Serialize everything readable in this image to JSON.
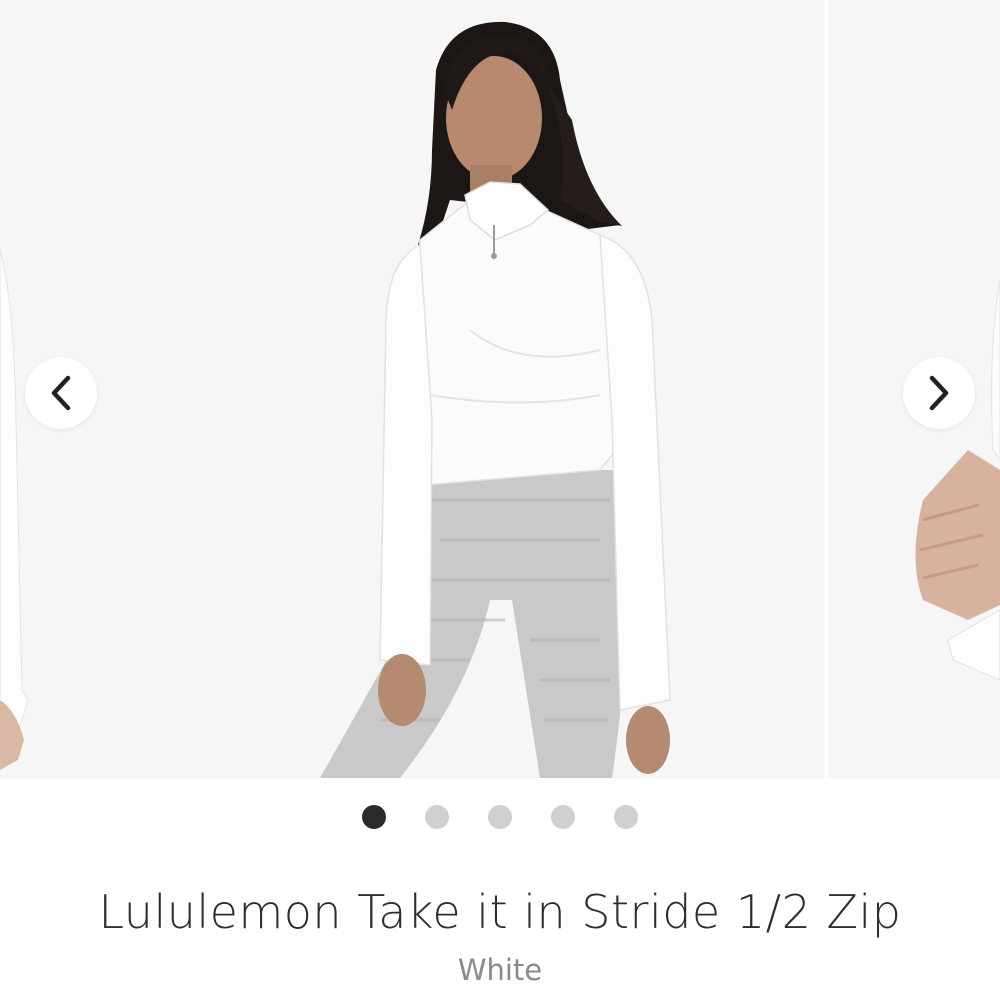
{
  "carousel": {
    "prev_icon": "chevron-left-icon",
    "next_icon": "chevron-right-icon",
    "slide_count": 5,
    "active_index": 0,
    "main_image": "model wearing white half-zip long-sleeve top and heather grey leggings",
    "next_image": "partial view of white sleeve and hand"
  },
  "product": {
    "title": "Lululemon Take it in Stride 1/2 Zip",
    "color": "White"
  },
  "colors": {
    "dot_active": "#2b2b2b",
    "dot_inactive": "#d0d0d0",
    "title_text": "#2e2e2e",
    "subtitle_text": "#8a8a8a"
  }
}
